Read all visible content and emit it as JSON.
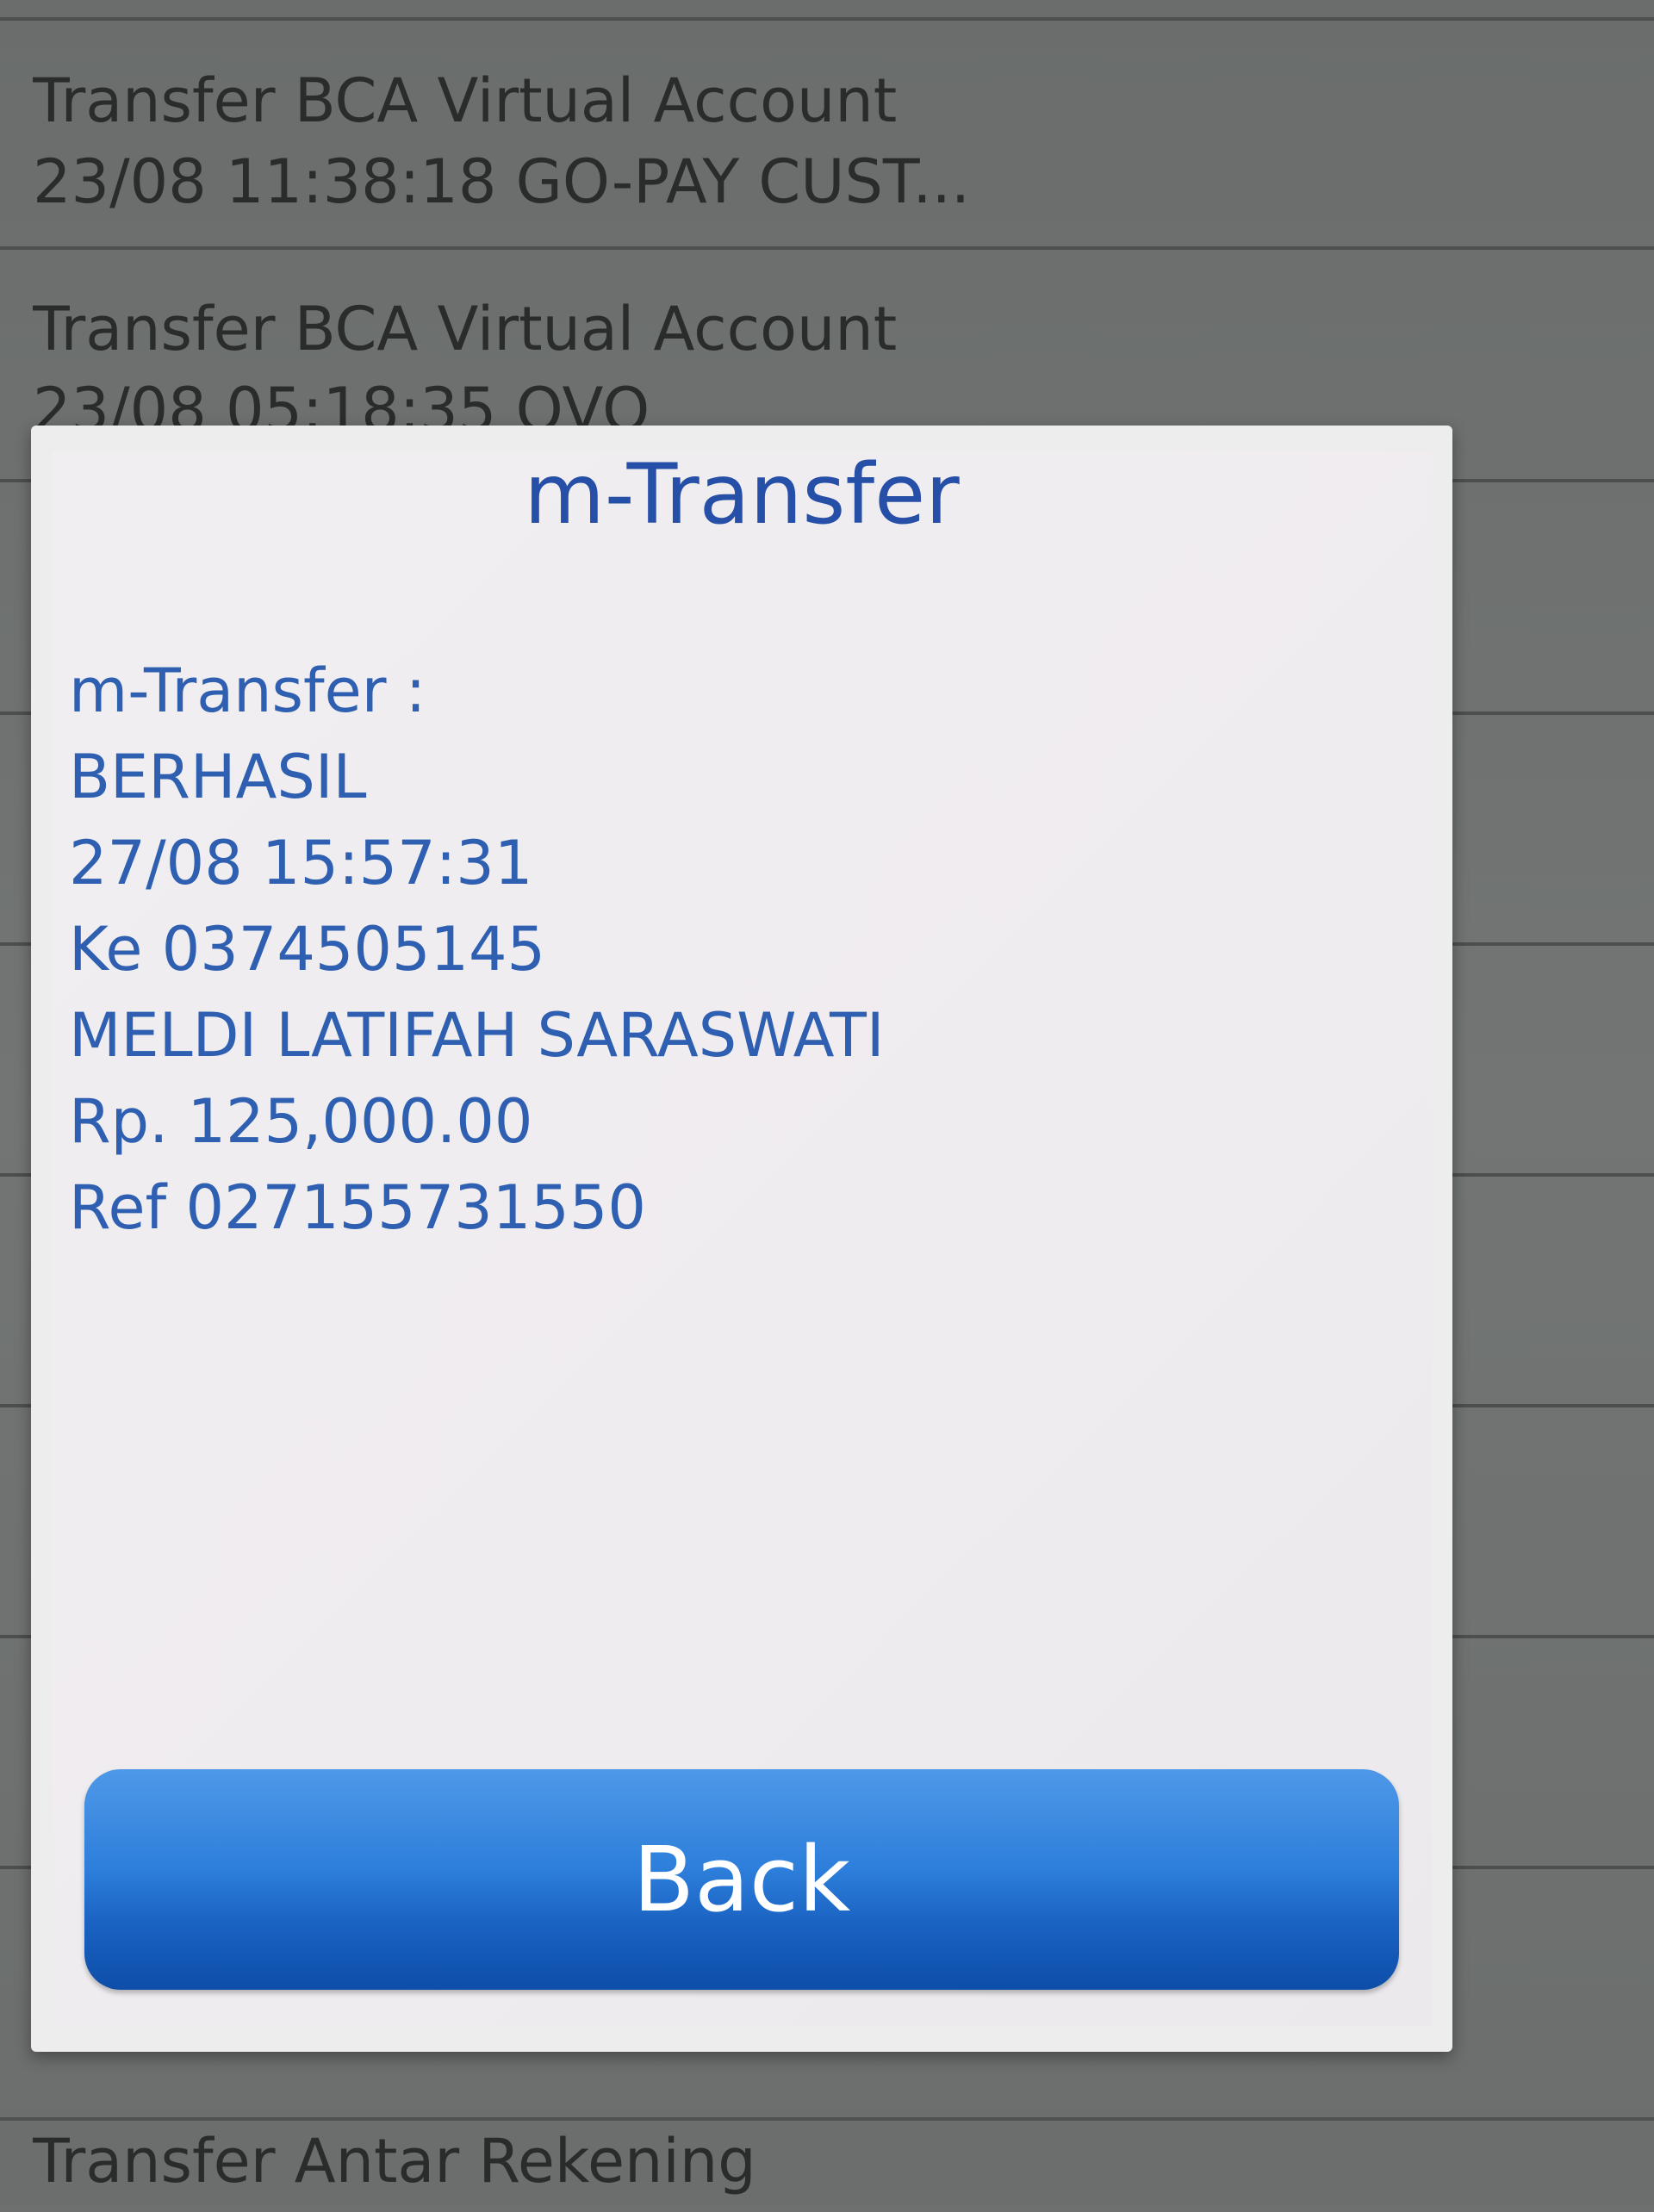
{
  "background_list": {
    "items": [
      {
        "title": "Transfer BCA Virtual Account",
        "subtitle": "23/08 11:38:18 GO-PAY CUST..."
      },
      {
        "title": "Transfer BCA Virtual Account",
        "subtitle": "23/08 05:18:35 OVO"
      }
    ],
    "bottom_item": {
      "title": "Transfer Antar Rekening"
    }
  },
  "dialog": {
    "title": "m-Transfer",
    "message_lines": [
      "m-Transfer :",
      "BERHASIL",
      "27/08 15:57:31",
      "Ke 0374505145",
      "MELDI LATIFAH SARASWATI",
      "Rp. 125,000.00",
      "Ref 027155731550"
    ],
    "back_label": "Back"
  },
  "colors": {
    "title_blue": "#2650a8",
    "text_blue": "#2e5fb0",
    "button_blue": "#1a62c2",
    "dialog_bg": "#efecef",
    "list_bg": "#6d706f"
  }
}
